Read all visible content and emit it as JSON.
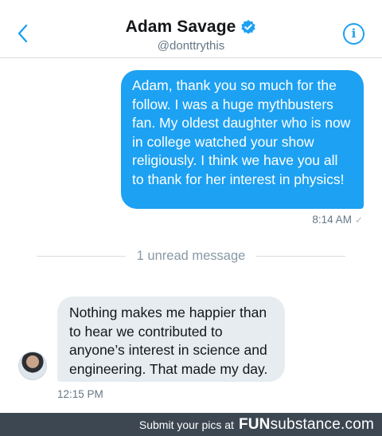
{
  "header": {
    "title": "Adam Savage",
    "handle": "@donttrythis",
    "verified_icon": "verified-badge-icon",
    "back_icon": "chevron-left-icon",
    "info_icon": "info-icon",
    "info_glyph": "i"
  },
  "messages": [
    {
      "direction": "outgoing",
      "text": "Adam, thank you so much for the follow. I was a huge mythbusters fan. My oldest daughter who is now in college watched your show religiously. I think we have you all to thank for her interest in physics!",
      "time": "8:14 AM",
      "status_icon": "check-icon",
      "status_glyph": "✓"
    },
    {
      "direction": "incoming",
      "text": "Nothing makes me happier than to hear we contributed to anyone’s interest in science and engineering. That made my day.",
      "time": "12:15 PM"
    }
  ],
  "divider": {
    "label": "1 unread message"
  },
  "footer": {
    "tagline": "Submit your pics at",
    "brand_bold": "FUN",
    "brand_rest": "substance.com"
  },
  "colors": {
    "accent": "#1da1f2",
    "incoming_bubble": "#e6ecf0",
    "footer_bg": "#3d4752"
  }
}
